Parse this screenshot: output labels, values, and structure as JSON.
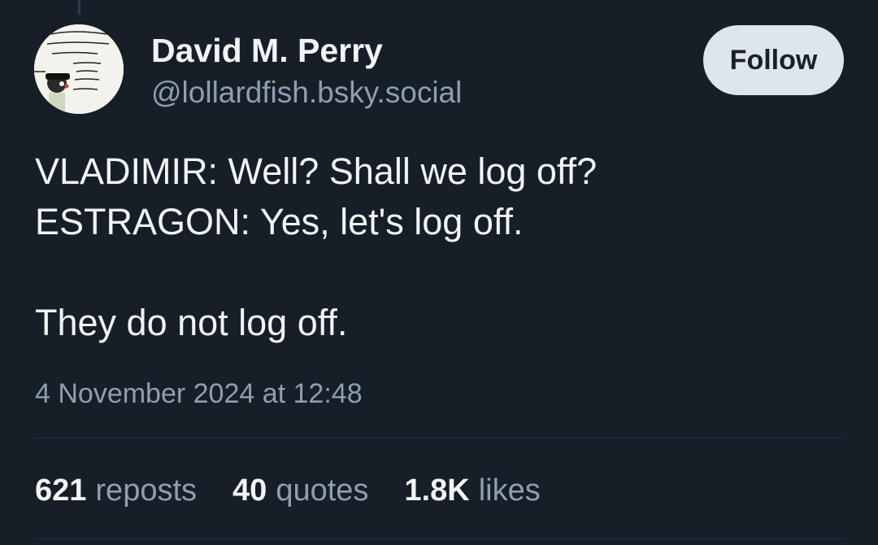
{
  "post": {
    "author": {
      "display_name": "David M. Perry",
      "handle": "@lollardfish.bsky.social",
      "avatar_icon": "comic-panel-avatar",
      "avatar_text": "IT'S HISTORY SATCHEL, NOT SOME FEEL-GOOD FAIRY TALE FOR LOSERS"
    },
    "follow_label": "Follow",
    "lines": [
      "VLADIMIR: Well? Shall we log off?",
      "ESTRAGON: Yes, let's log off.",
      "",
      "They do not log off."
    ],
    "timestamp": "4 November 2024 at 12:48",
    "stats": {
      "reposts": {
        "count": "621",
        "label": "reposts"
      },
      "quotes": {
        "count": "40",
        "label": "quotes"
      },
      "likes": {
        "count": "1.8K",
        "label": "likes"
      }
    }
  },
  "colors": {
    "background": "#161e27",
    "text_primary": "#f1f3f5",
    "text_secondary": "#8f9eb0",
    "follow_button_bg": "#dfe5ec",
    "divider": "#2a3441"
  }
}
